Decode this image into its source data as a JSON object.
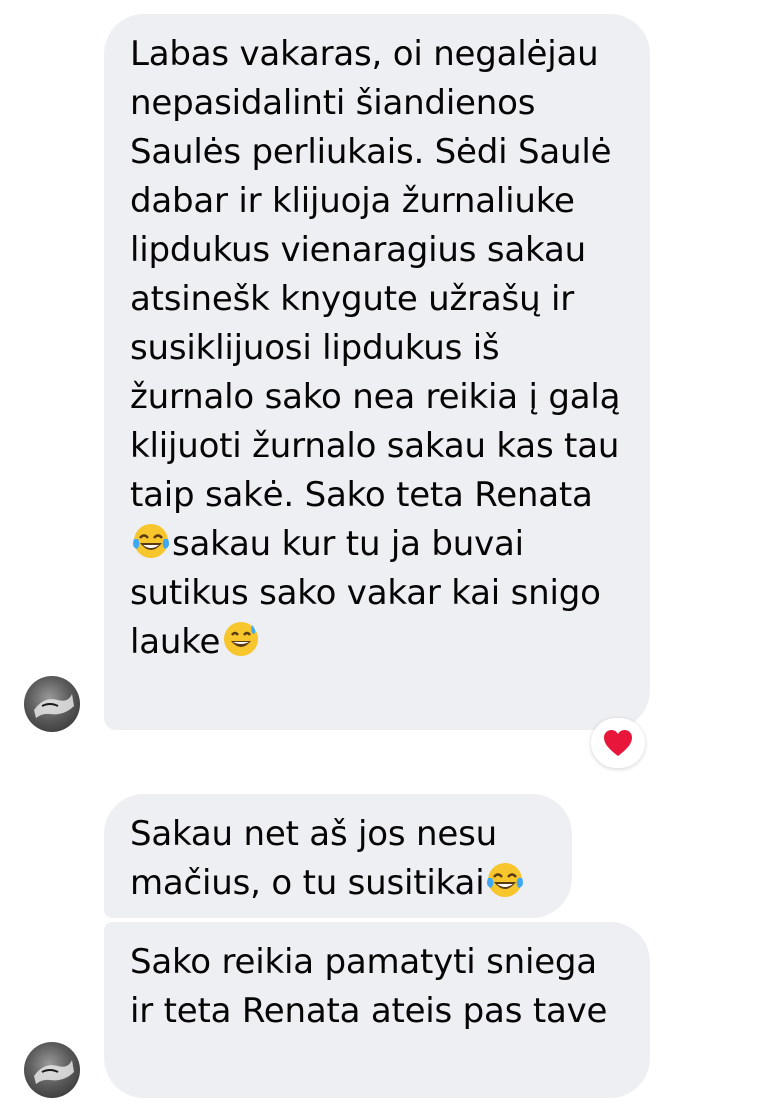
{
  "messages": [
    {
      "text_before_emoji_1": "Labas vakaras, oi negalėjau nepasidalinti šiandienos Saulės perliukais. Sėdi Saulė dabar ir klijuoja žurnaliuke lipdukus vienaragius sakau atsinešk knygute užrašų ir susiklijuosi lipdukus iš žurnalo sako nea reikia į galą klijuoti žurnalo sakau kas tau taip sakė. Sako teta Renata",
      "emoji_1": "face-with-tears-of-joy",
      "text_between": "sakau kur tu ja buvai sutikus sako vakar kai snigo lauke",
      "emoji_2": "grinning-face-with-sweat",
      "reaction": "red-heart"
    },
    {
      "text": "Sakau net aš jos nesu mačius, o tu susitikai",
      "emoji": "face-with-tears-of-joy"
    },
    {
      "text": "Sako reikia pamatyti sniega ir teta Renata ateis pas tave"
    }
  ],
  "colors": {
    "bubble": "#eeeff3",
    "text": "#050505",
    "heart": "#e8163b"
  }
}
